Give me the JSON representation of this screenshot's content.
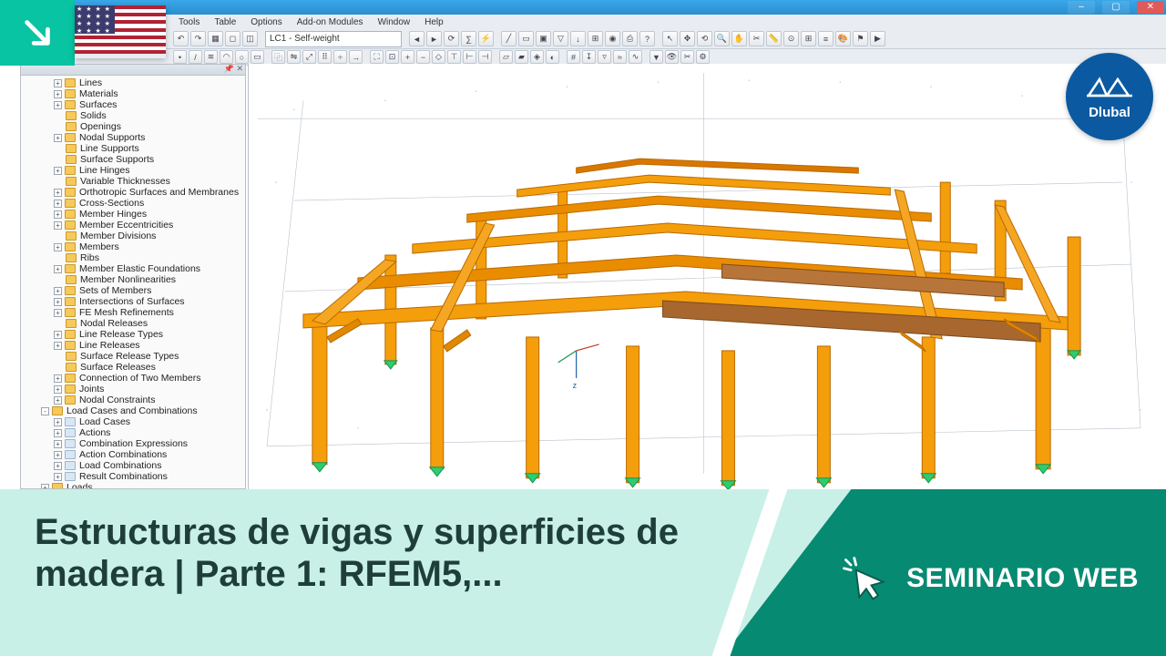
{
  "window": {
    "min": "–",
    "max": "▢",
    "close": "✕"
  },
  "menubar": [
    "Tools",
    "Table",
    "Options",
    "Add-on Modules",
    "Window",
    "Help"
  ],
  "toolbar": {
    "loadcase": "LC1 - Self-weight"
  },
  "navigator": {
    "modelData": [
      {
        "label": "Lines",
        "exp": "+"
      },
      {
        "label": "Materials",
        "exp": "+"
      },
      {
        "label": "Surfaces",
        "exp": "+"
      },
      {
        "label": "Solids"
      },
      {
        "label": "Openings"
      },
      {
        "label": "Nodal Supports",
        "exp": "+"
      },
      {
        "label": "Line Supports"
      },
      {
        "label": "Surface Supports"
      },
      {
        "label": "Line Hinges",
        "exp": "+"
      },
      {
        "label": "Variable Thicknesses"
      },
      {
        "label": "Orthotropic Surfaces and Membranes",
        "exp": "+"
      },
      {
        "label": "Cross-Sections",
        "exp": "+"
      },
      {
        "label": "Member Hinges",
        "exp": "+"
      },
      {
        "label": "Member Eccentricities",
        "exp": "+"
      },
      {
        "label": "Member Divisions"
      },
      {
        "label": "Members",
        "exp": "+"
      },
      {
        "label": "Ribs"
      },
      {
        "label": "Member Elastic Foundations",
        "exp": "+"
      },
      {
        "label": "Member Nonlinearities"
      },
      {
        "label": "Sets of Members",
        "exp": "+"
      },
      {
        "label": "Intersections of Surfaces",
        "exp": "+"
      },
      {
        "label": "FE Mesh Refinements",
        "exp": "+"
      },
      {
        "label": "Nodal Releases"
      },
      {
        "label": "Line Release Types",
        "exp": "+"
      },
      {
        "label": "Line Releases",
        "exp": "+"
      },
      {
        "label": "Surface Release Types"
      },
      {
        "label": "Surface Releases"
      },
      {
        "label": "Connection of Two Members",
        "exp": "+"
      },
      {
        "label": "Joints",
        "exp": "+"
      },
      {
        "label": "Nodal Constraints",
        "exp": "+"
      }
    ],
    "loadCasesGroup": {
      "label": "Load Cases and Combinations",
      "children": [
        {
          "label": "Load Cases",
          "exp": "+"
        },
        {
          "label": "Actions",
          "exp": "+"
        },
        {
          "label": "Combination Expressions",
          "exp": "+"
        },
        {
          "label": "Action Combinations",
          "exp": "+"
        },
        {
          "label": "Load Combinations",
          "exp": "+"
        },
        {
          "label": "Result Combinations",
          "exp": "+"
        }
      ]
    },
    "loads": {
      "label": "Loads"
    }
  },
  "logo": "Dlubal",
  "banner": {
    "title": "Estructuras de vigas y superficies de madera | Parte 1: RFEM5,...",
    "webinar": "SEMINARIO WEB"
  },
  "axes": {
    "z": "z"
  }
}
